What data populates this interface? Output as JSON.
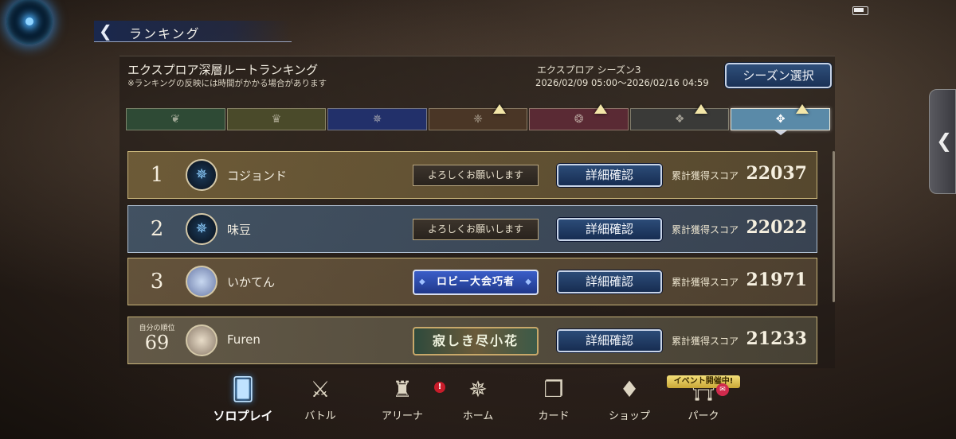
{
  "header": {
    "back_icon": "back-arrow-icon",
    "title": "ランキング"
  },
  "ranking": {
    "title": "エクスプロア深層ルートランキング",
    "notice": "※ランキングの反映には時間がかかる場合があります",
    "season_name": "エクスプロア シーズン3",
    "season_dates": "2026/02/09 05:00〜2026/02/16 04:59",
    "season_button": "シーズン選択"
  },
  "tabs": [
    {
      "icon": "leaf-icon",
      "glyph": "❦",
      "color": "#2e4a35",
      "up": false
    },
    {
      "icon": "crown-icon",
      "glyph": "♛",
      "color": "#4a4a2a",
      "up": false
    },
    {
      "icon": "rune-circle-icon",
      "glyph": "✵",
      "color": "#22306a",
      "up": false
    },
    {
      "icon": "dragon-icon",
      "glyph": "❈",
      "color": "#4a3626",
      "up": true
    },
    {
      "icon": "skull-icon",
      "glyph": "❂",
      "color": "#5a2a34",
      "up": true
    },
    {
      "icon": "horns-icon",
      "glyph": "❖",
      "color": "#3a3a38",
      "up": true
    },
    {
      "icon": "neutral-sigil-icon",
      "glyph": "✥",
      "color": "#5a8aa8",
      "up": true
    }
  ],
  "rows": [
    {
      "rank": "1",
      "name": "コジョンド",
      "title": "よろしくお願いします",
      "detail": "詳細確認",
      "score_label": "累計獲得スコア",
      "score": "22037"
    },
    {
      "rank": "2",
      "name": "味豆",
      "title": "よろしくお願いします",
      "detail": "詳細確認",
      "score_label": "累計獲得スコア",
      "score": "22022"
    },
    {
      "rank": "3",
      "name": "いかてん",
      "title": "ロビー大会巧者",
      "detail": "詳細確認",
      "score_label": "累計獲得スコア",
      "score": "21971"
    }
  ],
  "self_row": {
    "label": "自分の順位",
    "rank": "69",
    "name": "Furen",
    "title": "寂しき尽小花",
    "detail": "詳細確認",
    "score_label": "累計獲得スコア",
    "score": "21233"
  },
  "nav": [
    {
      "label": "ソロプレイ",
      "icon": "solo-cards-icon",
      "active": true
    },
    {
      "label": "バトル",
      "icon": "crossed-swords-icon",
      "active": false
    },
    {
      "label": "アリーナ",
      "icon": "trophy-icon",
      "active": false
    },
    {
      "label": "ホーム",
      "icon": "home-compass-icon",
      "active": false
    },
    {
      "label": "カード",
      "icon": "card-deck-icon",
      "active": false
    },
    {
      "label": "ショップ",
      "icon": "shop-crystal-icon",
      "active": false
    },
    {
      "label": "パーク",
      "icon": "park-gate-icon",
      "active": false
    }
  ],
  "event_tag": "イベント開催中!",
  "shop_notification": "!"
}
